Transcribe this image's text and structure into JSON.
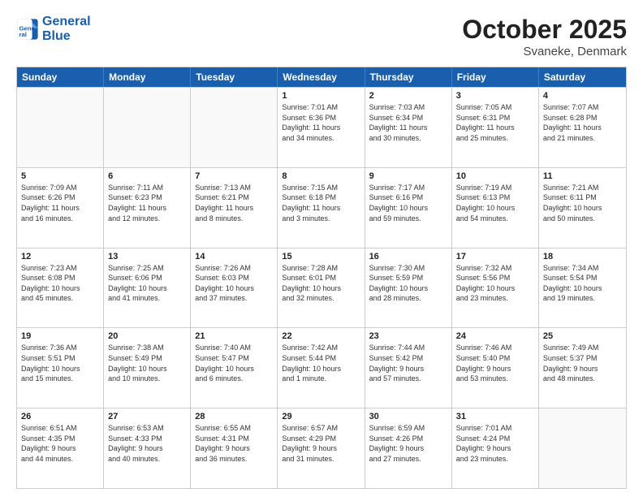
{
  "header": {
    "logo_line1": "General",
    "logo_line2": "Blue",
    "month": "October 2025",
    "location": "Svaneke, Denmark"
  },
  "weekdays": [
    "Sunday",
    "Monday",
    "Tuesday",
    "Wednesday",
    "Thursday",
    "Friday",
    "Saturday"
  ],
  "rows": [
    [
      {
        "day": "",
        "info": ""
      },
      {
        "day": "",
        "info": ""
      },
      {
        "day": "",
        "info": ""
      },
      {
        "day": "1",
        "info": "Sunrise: 7:01 AM\nSunset: 6:36 PM\nDaylight: 11 hours\nand 34 minutes."
      },
      {
        "day": "2",
        "info": "Sunrise: 7:03 AM\nSunset: 6:34 PM\nDaylight: 11 hours\nand 30 minutes."
      },
      {
        "day": "3",
        "info": "Sunrise: 7:05 AM\nSunset: 6:31 PM\nDaylight: 11 hours\nand 25 minutes."
      },
      {
        "day": "4",
        "info": "Sunrise: 7:07 AM\nSunset: 6:28 PM\nDaylight: 11 hours\nand 21 minutes."
      }
    ],
    [
      {
        "day": "5",
        "info": "Sunrise: 7:09 AM\nSunset: 6:26 PM\nDaylight: 11 hours\nand 16 minutes."
      },
      {
        "day": "6",
        "info": "Sunrise: 7:11 AM\nSunset: 6:23 PM\nDaylight: 11 hours\nand 12 minutes."
      },
      {
        "day": "7",
        "info": "Sunrise: 7:13 AM\nSunset: 6:21 PM\nDaylight: 11 hours\nand 8 minutes."
      },
      {
        "day": "8",
        "info": "Sunrise: 7:15 AM\nSunset: 6:18 PM\nDaylight: 11 hours\nand 3 minutes."
      },
      {
        "day": "9",
        "info": "Sunrise: 7:17 AM\nSunset: 6:16 PM\nDaylight: 10 hours\nand 59 minutes."
      },
      {
        "day": "10",
        "info": "Sunrise: 7:19 AM\nSunset: 6:13 PM\nDaylight: 10 hours\nand 54 minutes."
      },
      {
        "day": "11",
        "info": "Sunrise: 7:21 AM\nSunset: 6:11 PM\nDaylight: 10 hours\nand 50 minutes."
      }
    ],
    [
      {
        "day": "12",
        "info": "Sunrise: 7:23 AM\nSunset: 6:08 PM\nDaylight: 10 hours\nand 45 minutes."
      },
      {
        "day": "13",
        "info": "Sunrise: 7:25 AM\nSunset: 6:06 PM\nDaylight: 10 hours\nand 41 minutes."
      },
      {
        "day": "14",
        "info": "Sunrise: 7:26 AM\nSunset: 6:03 PM\nDaylight: 10 hours\nand 37 minutes."
      },
      {
        "day": "15",
        "info": "Sunrise: 7:28 AM\nSunset: 6:01 PM\nDaylight: 10 hours\nand 32 minutes."
      },
      {
        "day": "16",
        "info": "Sunrise: 7:30 AM\nSunset: 5:59 PM\nDaylight: 10 hours\nand 28 minutes."
      },
      {
        "day": "17",
        "info": "Sunrise: 7:32 AM\nSunset: 5:56 PM\nDaylight: 10 hours\nand 23 minutes."
      },
      {
        "day": "18",
        "info": "Sunrise: 7:34 AM\nSunset: 5:54 PM\nDaylight: 10 hours\nand 19 minutes."
      }
    ],
    [
      {
        "day": "19",
        "info": "Sunrise: 7:36 AM\nSunset: 5:51 PM\nDaylight: 10 hours\nand 15 minutes."
      },
      {
        "day": "20",
        "info": "Sunrise: 7:38 AM\nSunset: 5:49 PM\nDaylight: 10 hours\nand 10 minutes."
      },
      {
        "day": "21",
        "info": "Sunrise: 7:40 AM\nSunset: 5:47 PM\nDaylight: 10 hours\nand 6 minutes."
      },
      {
        "day": "22",
        "info": "Sunrise: 7:42 AM\nSunset: 5:44 PM\nDaylight: 10 hours\nand 1 minute."
      },
      {
        "day": "23",
        "info": "Sunrise: 7:44 AM\nSunset: 5:42 PM\nDaylight: 9 hours\nand 57 minutes."
      },
      {
        "day": "24",
        "info": "Sunrise: 7:46 AM\nSunset: 5:40 PM\nDaylight: 9 hours\nand 53 minutes."
      },
      {
        "day": "25",
        "info": "Sunrise: 7:49 AM\nSunset: 5:37 PM\nDaylight: 9 hours\nand 48 minutes."
      }
    ],
    [
      {
        "day": "26",
        "info": "Sunrise: 6:51 AM\nSunset: 4:35 PM\nDaylight: 9 hours\nand 44 minutes."
      },
      {
        "day": "27",
        "info": "Sunrise: 6:53 AM\nSunset: 4:33 PM\nDaylight: 9 hours\nand 40 minutes."
      },
      {
        "day": "28",
        "info": "Sunrise: 6:55 AM\nSunset: 4:31 PM\nDaylight: 9 hours\nand 36 minutes."
      },
      {
        "day": "29",
        "info": "Sunrise: 6:57 AM\nSunset: 4:29 PM\nDaylight: 9 hours\nand 31 minutes."
      },
      {
        "day": "30",
        "info": "Sunrise: 6:59 AM\nSunset: 4:26 PM\nDaylight: 9 hours\nand 27 minutes."
      },
      {
        "day": "31",
        "info": "Sunrise: 7:01 AM\nSunset: 4:24 PM\nDaylight: 9 hours\nand 23 minutes."
      },
      {
        "day": "",
        "info": ""
      }
    ]
  ]
}
